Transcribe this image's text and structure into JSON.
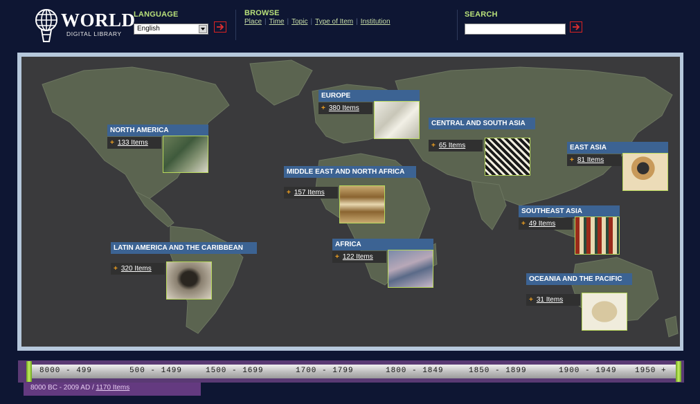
{
  "logo": {
    "word": "WORLD",
    "sub": "DIGITAL LIBRARY"
  },
  "language": {
    "label": "LANGUAGE",
    "selected": "English"
  },
  "browse": {
    "label": "BROWSE",
    "links": [
      "Place",
      "Time",
      "Topic",
      "Type of Item",
      "Institution"
    ]
  },
  "search": {
    "label": "SEARCH",
    "value": ""
  },
  "regions": [
    {
      "title": "NORTH AMERICA",
      "count": "133 Items"
    },
    {
      "title": "EUROPE",
      "count": "380 Items"
    },
    {
      "title": "CENTRAL AND SOUTH ASIA",
      "count": "65 Items"
    },
    {
      "title": "EAST ASIA",
      "count": "81 Items"
    },
    {
      "title": "MIDDLE EAST AND NORTH AFRICA",
      "count": "157 Items"
    },
    {
      "title": "SOUTHEAST ASIA",
      "count": "49 Items"
    },
    {
      "title": "LATIN AMERICA AND THE CARIBBEAN",
      "count": "320 Items"
    },
    {
      "title": "AFRICA",
      "count": "122 Items"
    },
    {
      "title": "OCEANIA AND THE PACIFIC",
      "count": "31 Items"
    }
  ],
  "timeline": {
    "ranges": [
      "8000 - 499",
      "500 - 1499",
      "1500 - 1699",
      "1700 - 1799",
      "1800 - 1849",
      "1850 - 1899",
      "1900 - 1949",
      "1950 +"
    ],
    "footer_range": "8000 BC - 2009 AD /",
    "footer_count": "1170 Items"
  },
  "colors": {
    "background": "#0e1633",
    "accent_label": "#b8e07a",
    "region_title": "#3c6393",
    "timeline": "#5a3a74"
  }
}
